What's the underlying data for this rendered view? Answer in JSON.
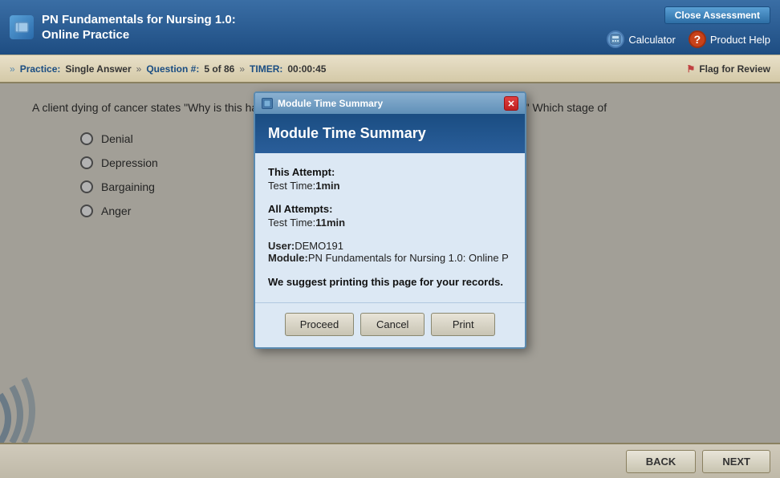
{
  "header": {
    "title_line1": "PN Fundamentals for Nursing 1.0:",
    "title_line2": "Online Practice",
    "close_assessment_label": "Close Assessment",
    "calculator_label": "Calculator",
    "product_help_label": "Product Help"
  },
  "toolbar": {
    "practice_label": "Practice:",
    "practice_value": "Single Answer",
    "question_label": "Question #:",
    "question_value": "5 of 86",
    "timer_label": "TIMER:",
    "timer_value": "00:00:45",
    "flag_label": "Flag for Review"
  },
  "question": {
    "text": "A client dying of cancer states \"Why is this happening to me.  Why can't it happen to someone else?\"  Which stage of"
  },
  "answers": [
    {
      "label": "Denial"
    },
    {
      "label": "Depression"
    },
    {
      "label": "Bargaining"
    },
    {
      "label": "Anger"
    }
  ],
  "footer": {
    "back_label": "BACK",
    "next_label": "NEXT"
  },
  "modal": {
    "titlebar_title": "Module Time Summary",
    "title": "Module Time Summary",
    "this_attempt_label": "This Attempt:",
    "this_attempt_value": "1min",
    "this_attempt_prefix": "Test Time:",
    "all_attempts_label": "All Attempts:",
    "all_attempts_value": "11min",
    "all_attempts_prefix": "Test Time:",
    "user_label": "User:",
    "user_value": "DEMO191",
    "module_label": "Module:",
    "module_value": "PN Fundamentals for Nursing 1.0: Online P",
    "suggestion": "We suggest printing this page for your records.",
    "proceed_label": "Proceed",
    "cancel_label": "Cancel",
    "print_label": "Print"
  }
}
